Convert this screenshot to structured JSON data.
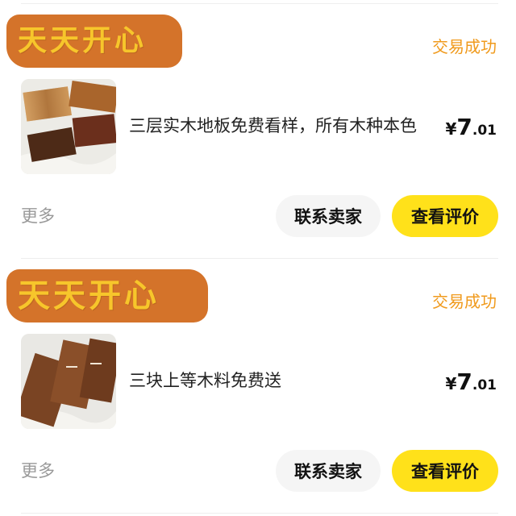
{
  "colors": {
    "accent_yellow": "#ffe11a",
    "status_orange": "#f09a1c",
    "badge_brown": "#d4732a",
    "badge_text": "#f7c62b",
    "button_gray": "#f5f5f5"
  },
  "orders": [
    {
      "shop_name": "天天开心",
      "status": "交易成功",
      "title": "三层实木地板免费看样，所有木种本色",
      "price": {
        "currency": "¥",
        "integer": "7",
        "decimal": ".01"
      },
      "thumbnail_icon": "wood-floor-samples-photo",
      "more_label": "更多",
      "contact_label": "联系卖家",
      "review_label": "查看评价"
    },
    {
      "shop_name": "天天开心",
      "status": "交易成功",
      "title": "三块上等木料免费送",
      "price": {
        "currency": "¥",
        "integer": "7",
        "decimal": ".01"
      },
      "thumbnail_icon": "wood-boards-photo",
      "more_label": "更多",
      "contact_label": "联系卖家",
      "review_label": "查看评价"
    }
  ]
}
